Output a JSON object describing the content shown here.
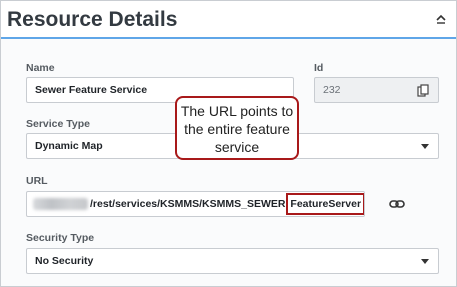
{
  "panel": {
    "title": "Resource Details",
    "collapse_icon": "chevron-up-icon"
  },
  "form": {
    "name": {
      "label": "Name",
      "value": "Sewer Feature Service"
    },
    "id": {
      "label": "Id",
      "value": "232",
      "copy_icon": "copy-icon"
    },
    "service_type": {
      "label": "Service Type",
      "value": "Dynamic Map"
    },
    "url": {
      "label": "URL",
      "value_main": "/rest/services/KSMMS/KSMMS_SEWER.",
      "value_highlight": "FeatureServer",
      "link_icon": "link-icon"
    },
    "security_type": {
      "label": "Security Type",
      "value": "No Security"
    }
  },
  "callout": {
    "text": "The URL points to the entire feature service",
    "border_color": "#a8191a"
  },
  "colors": {
    "accent": "#5fa6e8"
  }
}
